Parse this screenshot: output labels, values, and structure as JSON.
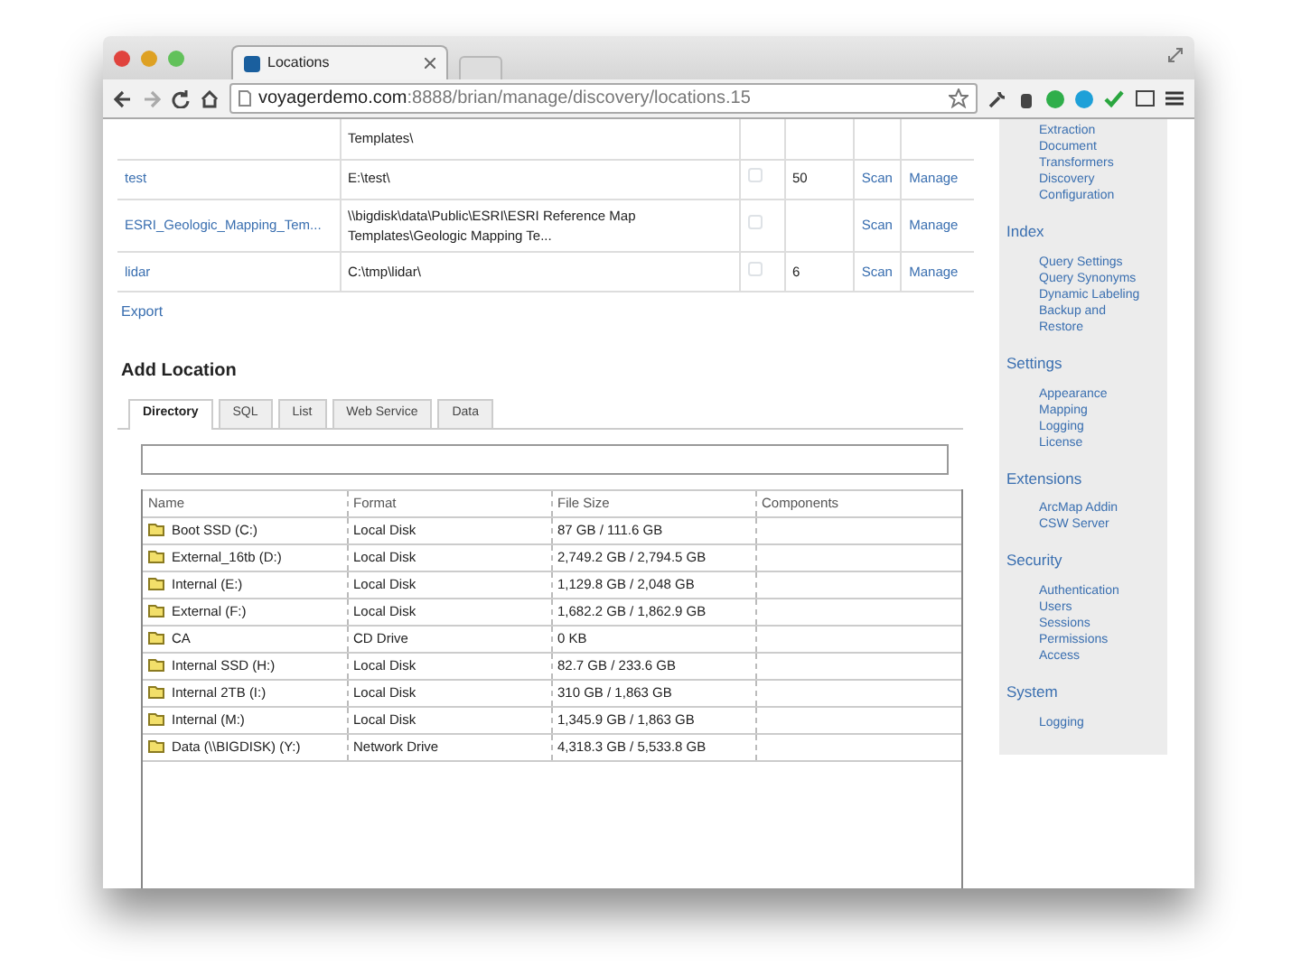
{
  "browser": {
    "tab_title": "Locations",
    "url_host": "voyagerdemo.com",
    "url_path": ":8888/brian/manage/discovery/locations.15"
  },
  "locations": {
    "partial_text": "Templates\\",
    "rows": [
      {
        "name": "test",
        "path": "E:\\test\\",
        "checked": false,
        "count": "50",
        "scan": "Scan",
        "manage": "Manage"
      },
      {
        "name": "ESRI_Geologic_Mapping_Tem...",
        "path": "\\\\bigdisk\\data\\Public\\ESRI\\ESRI Reference Map Templates\\Geologic Mapping Te...",
        "checked": false,
        "count": "",
        "scan": "Scan",
        "manage": "Manage"
      },
      {
        "name": "lidar",
        "path": "C:\\tmp\\lidar\\",
        "checked": false,
        "count": "6",
        "scan": "Scan",
        "manage": "Manage"
      }
    ],
    "export": "Export"
  },
  "add_location": {
    "title": "Add Location",
    "tabs": [
      {
        "label": "Directory",
        "selected": true
      },
      {
        "label": "SQL",
        "selected": false
      },
      {
        "label": "List",
        "selected": false
      },
      {
        "label": "Web Service",
        "selected": false
      },
      {
        "label": "Data",
        "selected": false
      }
    ],
    "columns": [
      "Name",
      "Format",
      "File Size",
      "Components"
    ],
    "drives": [
      {
        "name": "Boot SSD (C:)",
        "format": "Local Disk",
        "size": "87 GB / 111.6 GB"
      },
      {
        "name": "External_16tb (D:)",
        "format": "Local Disk",
        "size": "2,749.2 GB / 2,794.5 GB"
      },
      {
        "name": "Internal (E:)",
        "format": "Local Disk",
        "size": "1,129.8 GB / 2,048 GB"
      },
      {
        "name": "External (F:)",
        "format": "Local Disk",
        "size": "1,682.2 GB / 1,862.9 GB"
      },
      {
        "name": "CA",
        "format": "CD Drive",
        "size": "0 KB"
      },
      {
        "name": "Internal SSD (H:)",
        "format": "Local Disk",
        "size": "82.7 GB / 233.6 GB"
      },
      {
        "name": "Internal 2TB (I:)",
        "format": "Local Disk",
        "size": "310 GB / 1,863 GB"
      },
      {
        "name": "Internal (M:)",
        "format": "Local Disk",
        "size": "1,345.9 GB / 1,863 GB"
      },
      {
        "name": "Data (\\\\BIGDISK) (Y:)",
        "format": "Network Drive",
        "size": "4,318.3 GB / 5,533.8 GB"
      }
    ]
  },
  "sidebar": {
    "sections": [
      {
        "items": [
          "Extraction",
          "Document Transformers",
          "Discovery Configuration"
        ]
      },
      {
        "title": "Index",
        "items": [
          "Query Settings",
          "Query Synonyms",
          "Dynamic Labeling",
          "Backup and Restore"
        ]
      },
      {
        "title": "Settings",
        "items": [
          "Appearance",
          "Mapping",
          "Logging",
          "License"
        ]
      },
      {
        "title": "Extensions",
        "items": [
          "ArcMap Addin",
          "CSW Server"
        ]
      },
      {
        "title": "Security",
        "items": [
          "Authentication",
          "Users",
          "Sessions",
          "Permissions",
          "Access"
        ]
      },
      {
        "title": "System",
        "items": [
          "Logging"
        ]
      }
    ]
  }
}
